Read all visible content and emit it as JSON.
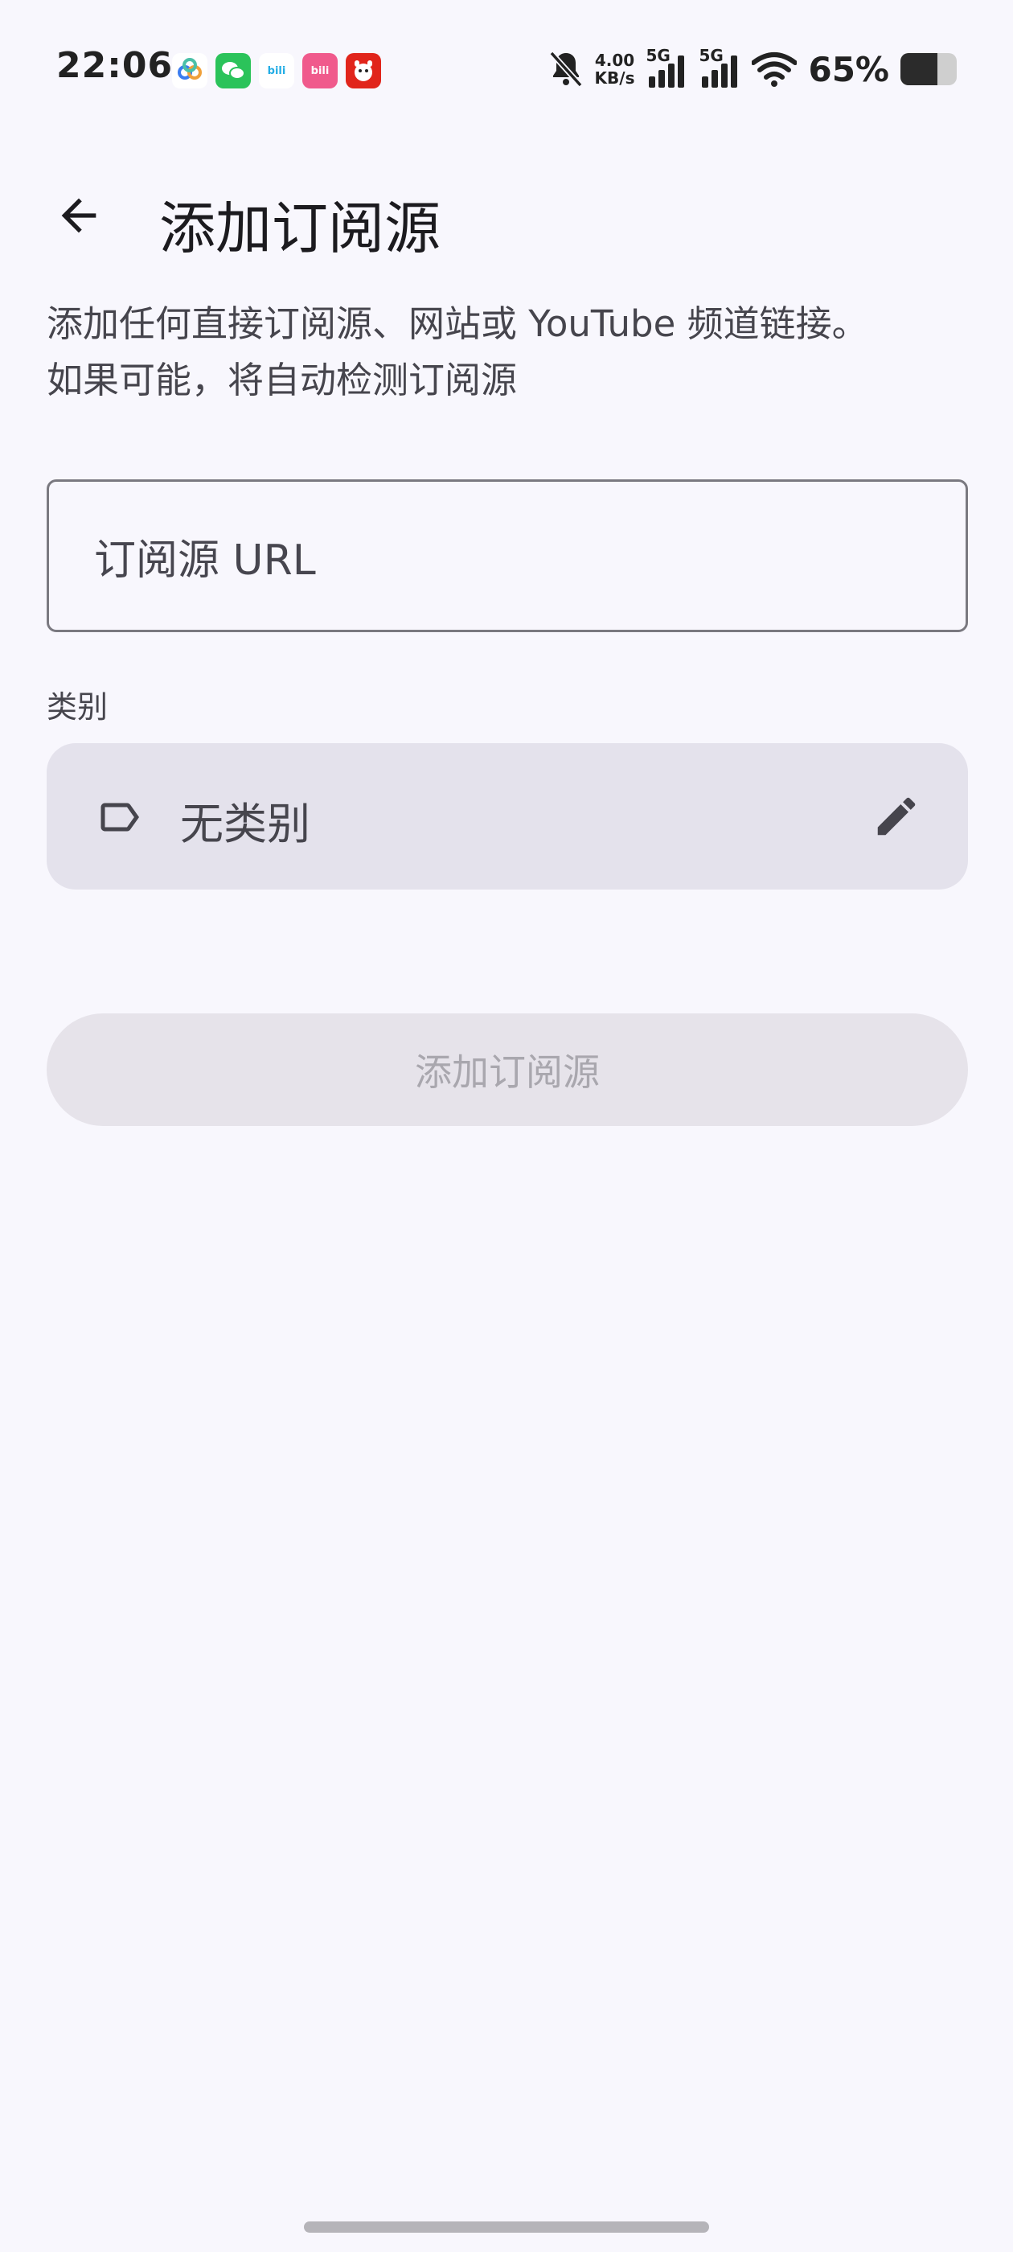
{
  "status_bar": {
    "time": "22:06",
    "net_speed_value": "4.00",
    "net_speed_unit": "KB/s",
    "signal1_label": "5G",
    "signal2_label": "5G",
    "battery_percent_text": "65%",
    "battery_level": 0.65,
    "notification_apps": [
      "baidu-netdisk-icon",
      "wechat-icon",
      "bilibili-icon",
      "bilibili-pink-icon",
      "jd-icon"
    ]
  },
  "header": {
    "title": "添加订阅源"
  },
  "description": {
    "line1": "添加任何直接订阅源、网站或 YouTube 频道链接。",
    "line2": "如果可能，将自动检测订阅源"
  },
  "url_field": {
    "placeholder": "订阅源 URL",
    "value": ""
  },
  "category": {
    "label": "类别",
    "selected": "无类别"
  },
  "actions": {
    "add_label": "添加订阅源",
    "add_enabled": false
  },
  "colors": {
    "background": "#f8f7fd",
    "chip_bg": "#e4e2ec",
    "button_disabled_bg": "#e6e3ea",
    "button_disabled_text": "#a9a7ae"
  }
}
